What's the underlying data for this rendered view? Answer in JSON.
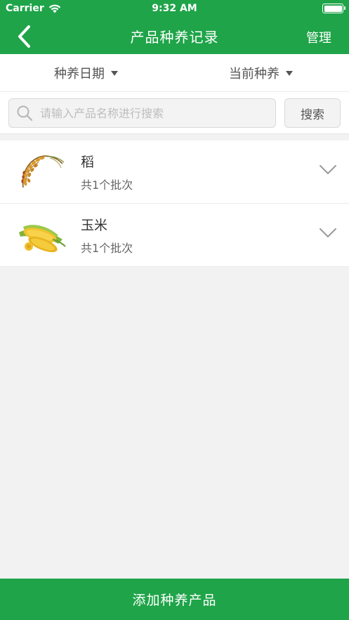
{
  "status_bar": {
    "carrier": "Carrier",
    "time": "9:32 AM"
  },
  "navbar": {
    "title": "产品种养记录",
    "right_action": "管理",
    "background_color": "#1fa449"
  },
  "filters": {
    "date_label": "种养日期",
    "current_label": "当前种养"
  },
  "search": {
    "placeholder": "请输入产品名称进行搜索",
    "value": "",
    "button_label": "搜索"
  },
  "products": [
    {
      "name": "稻",
      "batches": "共1个批次",
      "icon": "rice-stalk-icon"
    },
    {
      "name": "玉米",
      "batches": "共1个批次",
      "icon": "corn-icon"
    }
  ],
  "bottom": {
    "add_label": "添加种养产品"
  }
}
